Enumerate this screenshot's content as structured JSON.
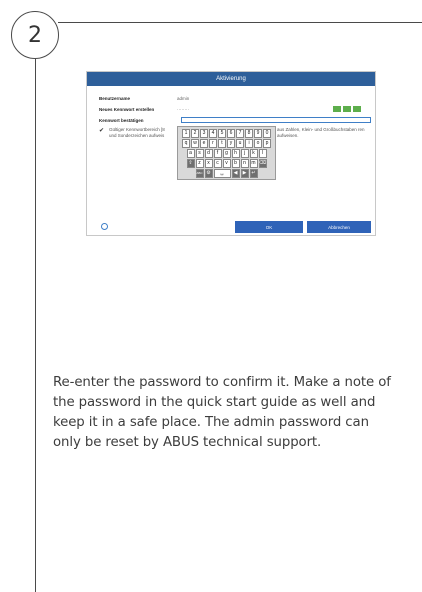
{
  "step": {
    "number": "2"
  },
  "screenshot": {
    "title": "Aktivierung",
    "fields": [
      {
        "label": "Benutzername",
        "value": "admin"
      },
      {
        "label": "Neues Kennwort erstellen",
        "value": "········"
      },
      {
        "label": "Kennwort bestätigen",
        "value": ""
      }
    ],
    "hint_left": "Gültiger Kennwortbereich [8 und Sonderzeichen aufweis",
    "hint_right": "aus Zahlen, Klein- und Großbuchstaben ren aufweisen.",
    "keyboard": {
      "rows": [
        [
          "1",
          "2",
          "3",
          "4",
          "5",
          "6",
          "7",
          "8",
          "9",
          "0"
        ],
        [
          "q",
          "w",
          "e",
          "r",
          "t",
          "y",
          "u",
          "i",
          "o",
          "p"
        ],
        [
          "a",
          "s",
          "d",
          "f",
          "g",
          "h",
          "j",
          "k",
          "l"
        ],
        [
          "⇧",
          "z",
          "x",
          "c",
          "v",
          "b",
          "n",
          "m",
          "⌫"
        ],
        [
          "ABC",
          "⚙",
          "␣",
          "◀",
          "▶",
          "↵"
        ]
      ]
    },
    "ok_label": "OK",
    "cancel_label": "Abbrechen",
    "strength_color": "#5dae4c",
    "accent_color": "#2f63b8"
  },
  "instruction": "Re-enter the password to confirm it. Make a note of the password in the quick start guide as well and keep it in a safe place. The admin password can only be reset by ABUS technical support."
}
